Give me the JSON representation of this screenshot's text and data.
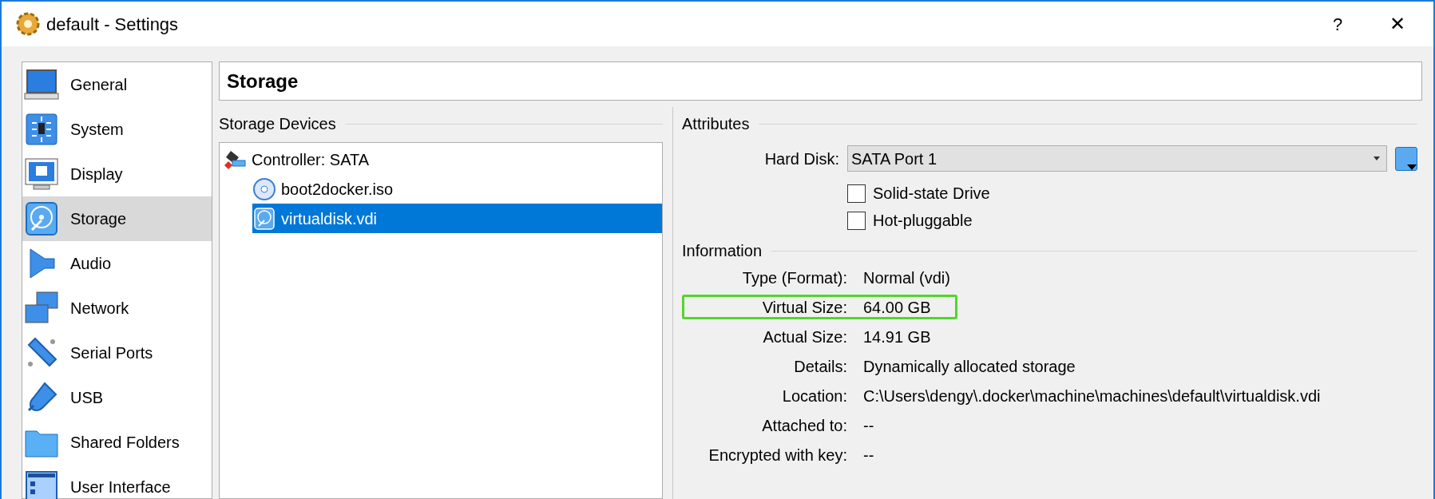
{
  "window": {
    "title": "default - Settings",
    "help": "?",
    "close": "✕"
  },
  "sidebar": {
    "items": [
      {
        "label": "General",
        "selected": false
      },
      {
        "label": "System",
        "selected": false
      },
      {
        "label": "Display",
        "selected": false
      },
      {
        "label": "Storage",
        "selected": true
      },
      {
        "label": "Audio",
        "selected": false
      },
      {
        "label": "Network",
        "selected": false
      },
      {
        "label": "Serial Ports",
        "selected": false
      },
      {
        "label": "USB",
        "selected": false
      },
      {
        "label": "Shared Folders",
        "selected": false
      },
      {
        "label": "User Interface",
        "selected": false
      }
    ]
  },
  "page_title": "Storage",
  "storage_devices": {
    "label": "Storage Devices",
    "tree": [
      {
        "kind": "controller",
        "label": "Controller: SATA",
        "selected": false,
        "children": [
          {
            "kind": "optical",
            "label": "boot2docker.iso",
            "selected": false
          },
          {
            "kind": "harddisk",
            "label": "virtualdisk.vdi",
            "selected": true
          }
        ]
      }
    ]
  },
  "attributes": {
    "label": "Attributes",
    "hard_disk": {
      "label": "Hard Disk:",
      "value": "SATA Port 1"
    },
    "checkboxes": [
      {
        "label": "Solid-state Drive",
        "checked": false
      },
      {
        "label": "Hot-pluggable",
        "checked": false
      }
    ]
  },
  "information": {
    "label": "Information",
    "rows": [
      {
        "label": "Type (Format):",
        "value": "Normal (vdi)",
        "highlighted": false
      },
      {
        "label": "Virtual Size:",
        "value": "64.00 GB",
        "highlighted": true
      },
      {
        "label": "Actual Size:",
        "value": "14.91 GB",
        "highlighted": false
      },
      {
        "label": "Details:",
        "value": "Dynamically allocated storage",
        "highlighted": false
      },
      {
        "label": "Location:",
        "value": "C:\\Users\\dengy\\.docker\\machine\\machines\\default\\virtualdisk.vdi",
        "highlighted": false
      },
      {
        "label": "Attached to:",
        "value": "--",
        "highlighted": false
      },
      {
        "label": "Encrypted with key:",
        "value": "--",
        "highlighted": false
      }
    ]
  }
}
